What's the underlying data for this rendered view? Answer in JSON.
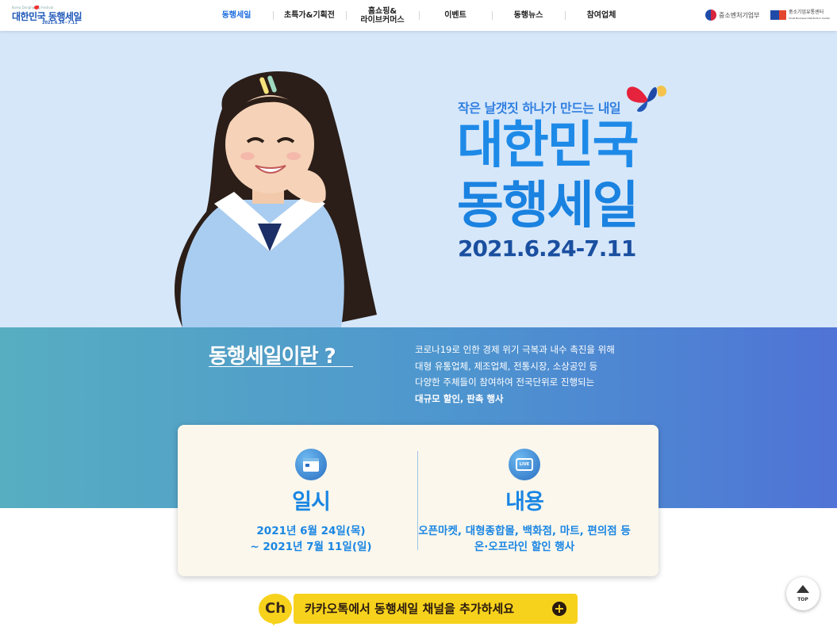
{
  "header": {
    "logo": {
      "small": "Korea Donghaeng Festival",
      "title": "대한민국 동행세일",
      "date": "2021.6.24~7.11"
    },
    "nav": [
      {
        "label": "동행세일",
        "active": true
      },
      {
        "label": "초특가&기획전",
        "active": false
      },
      {
        "label": "홈쇼핑&\n라이브커머스",
        "active": false
      },
      {
        "label": "이벤트",
        "active": false
      },
      {
        "label": "동행뉴스",
        "active": false
      },
      {
        "label": "참여업체",
        "active": false
      }
    ],
    "partner_mss": "중소벤처기업부",
    "partner_sbdc": "중소기업유통센터",
    "partner_sbdc_sub": "Small Business Distribution Center"
  },
  "hero": {
    "tagline": "작은 날갯짓 하나가 만드는 내일",
    "title_line1": "대한민국",
    "title_line2": "동행세일",
    "period": "2021.6.24-7.11"
  },
  "intro": {
    "title": "동행세일이란 ?",
    "desc_line1": "코로나19로 인한 경제 위기 극복과 내수 촉진을 위해",
    "desc_line2": "대형 유통업체, 제조업체, 전통시장, 소상공인 등",
    "desc_line3": "다양한 주체들이 참여하여 전국단위로 진행되는",
    "desc_line4": "대규모 할인, 판촉 행사"
  },
  "info_card": {
    "schedule": {
      "icon": "calendar-icon",
      "heading": "일시",
      "body": "2021년 6월 24일(목)\n~ 2021년 7월 11일(일)"
    },
    "content": {
      "icon": "live-tv-icon",
      "heading": "내용",
      "icon_text": "LIVE",
      "body": "오픈마켓, 대형종합몰, 백화점, 마트, 편의점 등\n온·오프라인 할인 행사"
    }
  },
  "kakao_banner": {
    "ch_label": "Ch",
    "text": "카카오톡에서 동행세일 채널을 추가하세요",
    "plus": "+"
  },
  "top_button": {
    "label": "TOP"
  },
  "colors": {
    "primary_blue": "#1a86e3",
    "hero_bg": "#d6e7fa",
    "kakao_yellow": "#f7d21c",
    "card_bg": "#fbf7ec"
  }
}
